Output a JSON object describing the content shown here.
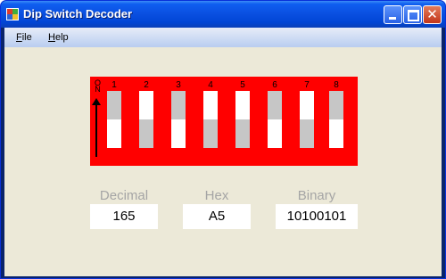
{
  "window": {
    "title": "Dip Switch Decoder",
    "close_symbol": "✕"
  },
  "menu": {
    "items": [
      {
        "label": "File"
      },
      {
        "label": "Help"
      }
    ]
  },
  "dip_switch": {
    "on_label": "O N",
    "switches": [
      {
        "number": "1",
        "state": "on"
      },
      {
        "number": "2",
        "state": "off"
      },
      {
        "number": "3",
        "state": "on"
      },
      {
        "number": "4",
        "state": "off"
      },
      {
        "number": "5",
        "state": "off"
      },
      {
        "number": "6",
        "state": "on"
      },
      {
        "number": "7",
        "state": "off"
      },
      {
        "number": "8",
        "state": "on"
      }
    ],
    "board_color": "#ff0000"
  },
  "outputs": {
    "decimal": {
      "label": "Decimal",
      "value": "165"
    },
    "hex": {
      "label": "Hex",
      "value": "A5"
    },
    "binary": {
      "label": "Binary",
      "value": "10100101"
    }
  }
}
